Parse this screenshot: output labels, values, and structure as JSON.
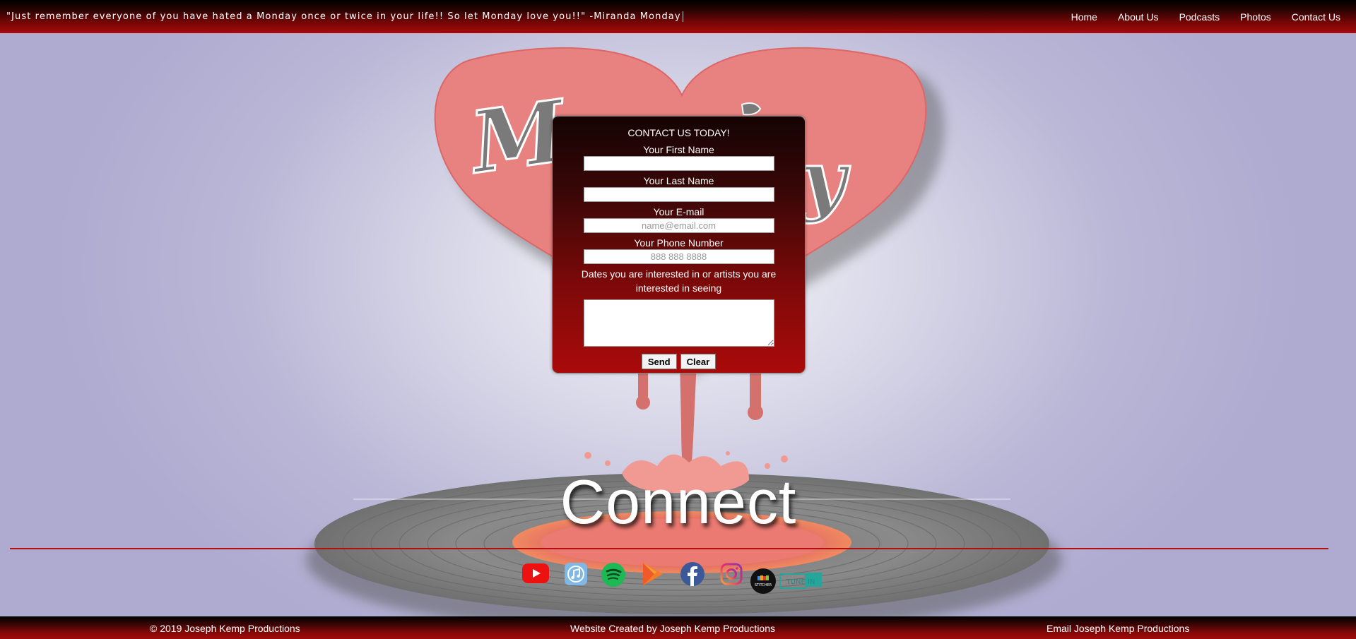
{
  "header": {
    "quote": "\"Just remember everyone of you have hated a Monday once or twice in your life!! So let Monday love you!!\" -Miranda Monday",
    "nav": [
      "Home",
      "About Us",
      "Podcasts",
      "Photos",
      "Contact Us"
    ]
  },
  "background": {
    "logo_text_left": "M",
    "logo_text_right": "ay"
  },
  "form": {
    "title": "CONTACT US TODAY!",
    "first_name_label": "Your First Name",
    "first_name_value": "",
    "last_name_label": "Your Last Name",
    "last_name_value": "",
    "email_label": "Your E-mail",
    "email_placeholder": "name@email.com",
    "phone_label": "Your Phone Number",
    "phone_placeholder": "888 888 8888",
    "dates_label": "Dates you are interested in or artists you are interested in seeing",
    "dates_value": "",
    "send_label": "Send",
    "clear_label": "Clear"
  },
  "connect": {
    "heading": "Connect",
    "social_icons": [
      "youtube-icon",
      "itunes-icon",
      "spotify-icon",
      "google-play-icon",
      "facebook-icon",
      "instagram-icon",
      "stitcher-icon",
      "tunein-icon"
    ],
    "stitcher_text": "STITCHER",
    "tunein_text": "TUNE IN"
  },
  "colors": {
    "header_red": "#a80a0a",
    "heart": "#e57a78",
    "divider": "#b01010"
  },
  "footer": {
    "copyright": "© 2019 Joseph Kemp Productions",
    "credit": "Website Created by Joseph Kemp Productions",
    "email": "Email Joseph Kemp Productions"
  }
}
